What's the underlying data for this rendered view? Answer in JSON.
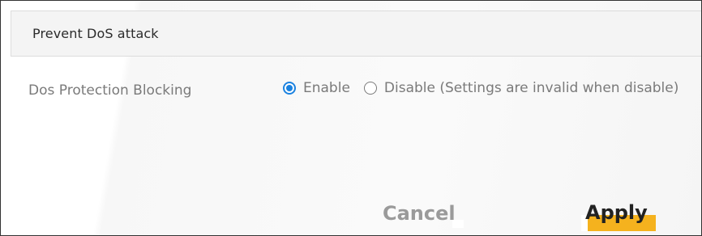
{
  "section": {
    "title": "Prevent DoS attack"
  },
  "dos_protection": {
    "label": "Dos Protection Blocking",
    "options": [
      {
        "label": "Enable",
        "selected": true
      },
      {
        "label": "Disable (Settings are invalid when disable)",
        "selected": false
      }
    ]
  },
  "buttons": {
    "cancel_label": "Cancel",
    "apply_label": "Apply"
  },
  "colors": {
    "radio_accent": "#1b82e0",
    "apply_highlight": "#f5b21e"
  }
}
